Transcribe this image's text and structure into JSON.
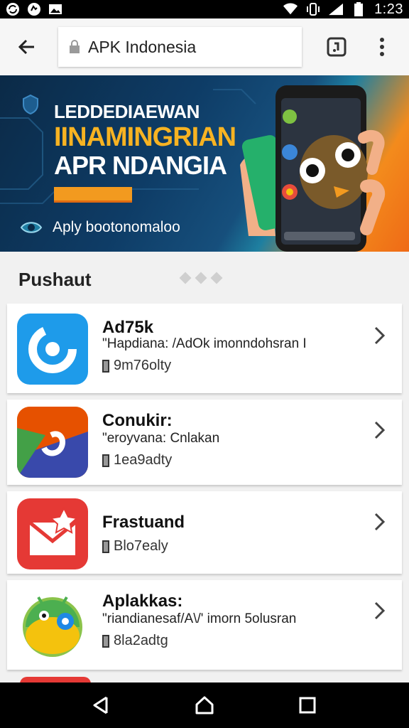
{
  "status_bar": {
    "time": "1:23",
    "left_icons": [
      "sync-icon",
      "location-icon",
      "image-icon"
    ],
    "right_icons": [
      "wifi-icon",
      "vibrate-icon",
      "signal-icon",
      "battery-icon"
    ]
  },
  "browser": {
    "url": "APK Indonesia",
    "back_icon": "arrow-left-icon",
    "tab_icon": "tab-switch-icon",
    "menu_icon": "more-vert-icon"
  },
  "banner": {
    "line1": "LEDDEDIAEWAN",
    "line2": "IINAMINGRIAN",
    "line3": "APR NDANGIA",
    "cta": "Aply bootonomaloo",
    "colors": {
      "accent": "#f7b322",
      "bar": "#f29a1f",
      "bg": "#0e3c66"
    }
  },
  "section": {
    "title": "Pushaut"
  },
  "apps": [
    {
      "name": "Ad75k",
      "description": "\"Hapdiana: /AdOk imonndohsran I",
      "meta": "9m76olty",
      "icon": "sync-circle-icon"
    },
    {
      "name": "Conukir:",
      "description": "\"eroyvana: Cnlakan",
      "meta": "1ea9adty",
      "icon": "colorful-app-icon"
    },
    {
      "name": "Frastuand",
      "description": "",
      "meta": "Blo7ealy",
      "icon": "star-mail-icon"
    },
    {
      "name": "Aplakkas:",
      "description": "\"riandianesaf/A\\/' imorn 5olusran",
      "meta": "8la2adtg",
      "icon": "android-icon"
    }
  ]
}
